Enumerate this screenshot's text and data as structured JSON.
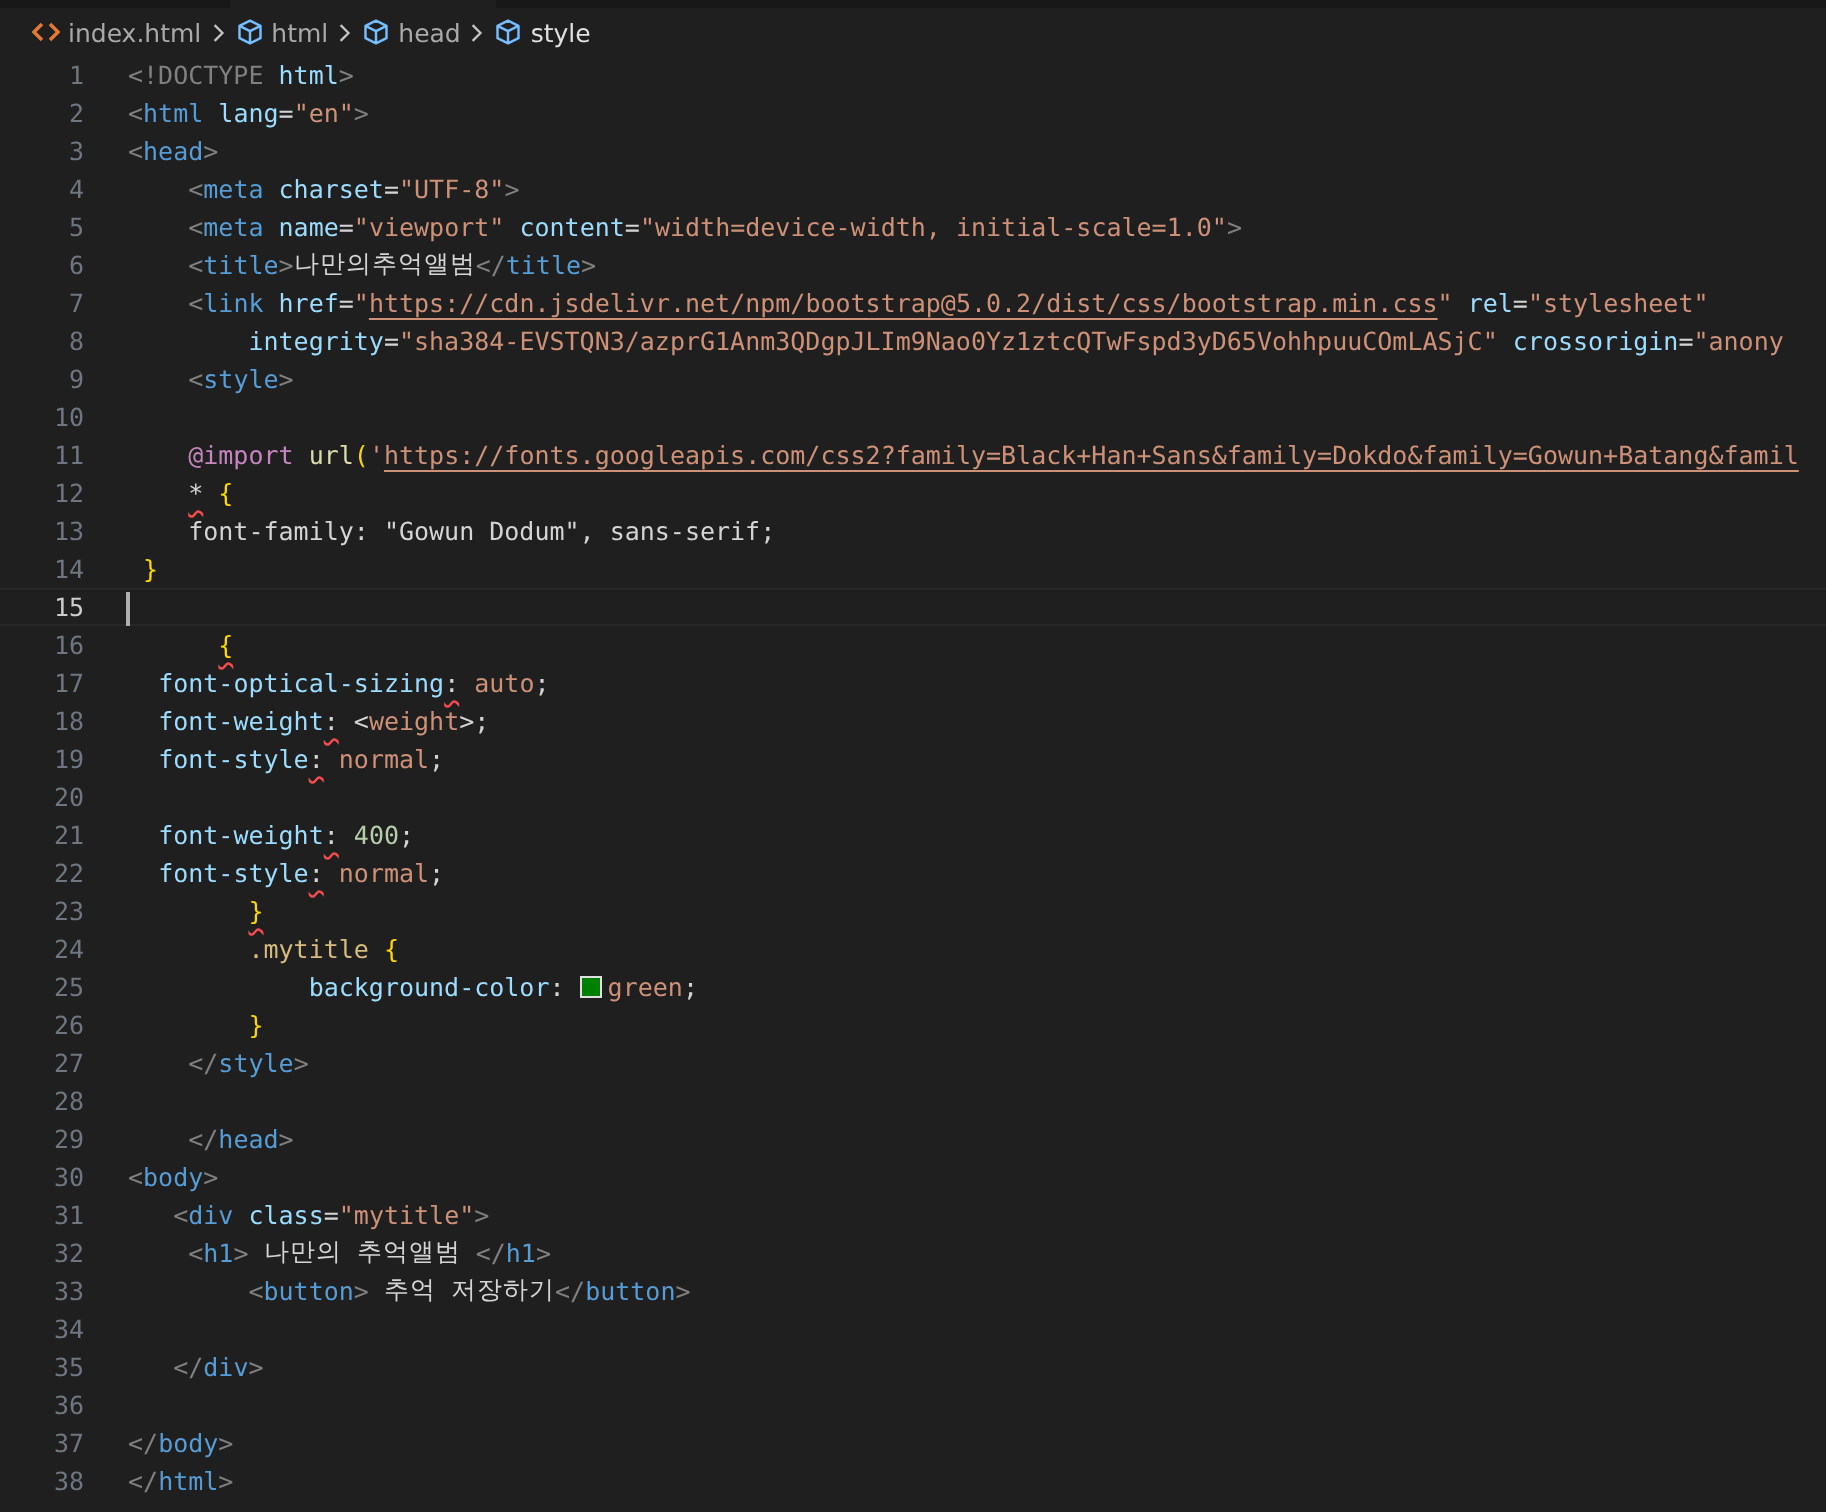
{
  "breadcrumb": [
    {
      "kind": "file",
      "label": "index.html"
    },
    {
      "kind": "element",
      "label": "html"
    },
    {
      "kind": "element",
      "label": "head"
    },
    {
      "kind": "element",
      "label": "style"
    }
  ],
  "lines": [
    {
      "number": "1",
      "tokens": [
        {
          "kind": "punct",
          "text": "<!DOCTYPE"
        },
        {
          "kind": "attr",
          "text": " html"
        },
        {
          "kind": "punct",
          "text": ">"
        }
      ]
    },
    {
      "number": "2",
      "tokens": [
        {
          "kind": "punct",
          "text": "<"
        },
        {
          "kind": "tag",
          "text": "html"
        },
        {
          "kind": "attr",
          "text": " lang"
        },
        {
          "kind": "plain",
          "text": "="
        },
        {
          "kind": "string",
          "text": "\"en\""
        },
        {
          "kind": "punct",
          "text": ">"
        }
      ]
    },
    {
      "number": "3",
      "tokens": [
        {
          "kind": "punct",
          "text": "<"
        },
        {
          "kind": "tag",
          "text": "head"
        },
        {
          "kind": "punct",
          "text": ">"
        }
      ]
    },
    {
      "number": "4",
      "tokens": [
        {
          "kind": "punct",
          "text": "    <"
        },
        {
          "kind": "tag",
          "text": "meta"
        },
        {
          "kind": "attr",
          "text": " charset"
        },
        {
          "kind": "plain",
          "text": "="
        },
        {
          "kind": "string",
          "text": "\"UTF-8\""
        },
        {
          "kind": "punct",
          "text": ">"
        }
      ]
    },
    {
      "number": "5",
      "tokens": [
        {
          "kind": "punct",
          "text": "    <"
        },
        {
          "kind": "tag",
          "text": "meta"
        },
        {
          "kind": "attr",
          "text": " name"
        },
        {
          "kind": "plain",
          "text": "="
        },
        {
          "kind": "string",
          "text": "\"viewport\""
        },
        {
          "kind": "attr",
          "text": " content"
        },
        {
          "kind": "plain",
          "text": "="
        },
        {
          "kind": "string",
          "text": "\"width=device-width, initial-scale=1.0\""
        },
        {
          "kind": "punct",
          "text": ">"
        }
      ]
    },
    {
      "number": "6",
      "tokens": [
        {
          "kind": "punct",
          "text": "    <"
        },
        {
          "kind": "tag",
          "text": "title"
        },
        {
          "kind": "punct",
          "text": ">"
        },
        {
          "kind": "text",
          "text": "나만의추억앨범"
        },
        {
          "kind": "punct",
          "text": "</"
        },
        {
          "kind": "tag",
          "text": "title"
        },
        {
          "kind": "punct",
          "text": ">"
        }
      ]
    },
    {
      "number": "7",
      "tokens": [
        {
          "kind": "punct",
          "text": "    <"
        },
        {
          "kind": "tag",
          "text": "link"
        },
        {
          "kind": "attr",
          "text": " href"
        },
        {
          "kind": "plain",
          "text": "="
        },
        {
          "kind": "string",
          "text": "\""
        },
        {
          "kind": "link",
          "text": "https://cdn.jsdelivr.net/npm/bootstrap@5.0.2/dist/css/bootstrap.min.css"
        },
        {
          "kind": "string",
          "text": "\""
        },
        {
          "kind": "attr",
          "text": " rel"
        },
        {
          "kind": "plain",
          "text": "="
        },
        {
          "kind": "string",
          "text": "\"stylesheet\""
        }
      ]
    },
    {
      "number": "8",
      "tokens": [
        {
          "kind": "attr",
          "text": "        integrity"
        },
        {
          "kind": "plain",
          "text": "="
        },
        {
          "kind": "string",
          "text": "\"sha384-EVSTQN3/azprG1Anm3QDgpJLIm9Nao0Yz1ztcQTwFspd3yD65VohhpuuCOmLASjC\""
        },
        {
          "kind": "attr",
          "text": " crossorigin"
        },
        {
          "kind": "plain",
          "text": "="
        },
        {
          "kind": "string",
          "text": "\"anony"
        }
      ]
    },
    {
      "number": "9",
      "tokens": [
        {
          "kind": "punct",
          "text": "    <"
        },
        {
          "kind": "tag",
          "text": "style"
        },
        {
          "kind": "punct",
          "text": ">"
        }
      ]
    },
    {
      "number": "10"
    },
    {
      "number": "11",
      "tokens": [
        {
          "kind": "keyword",
          "text": "    @import"
        },
        {
          "kind": "func",
          "text": " url"
        },
        {
          "kind": "bracket",
          "text": "("
        },
        {
          "kind": "string",
          "text": "'"
        },
        {
          "kind": "link",
          "text": "https://fonts.googleapis.com/css2?family=Black+Han+Sans&family=Dokdo&family=Gowun+Batang&famil"
        }
      ]
    },
    {
      "number": "12",
      "tokens": [
        {
          "kind": "plain",
          "text": "    *",
          "error": true
        },
        {
          "kind": "bracket",
          "text": " {"
        }
      ]
    },
    {
      "number": "13",
      "tokens": [
        {
          "kind": "plain",
          "text": "    font-family: \"Gowun Dodum\", sans-serif;"
        }
      ]
    },
    {
      "number": "14",
      "tokens": [
        {
          "kind": "bracket",
          "text": " }"
        }
      ]
    },
    {
      "number": "15",
      "current": true
    },
    {
      "number": "16",
      "tokens": [
        {
          "kind": "bracket",
          "text": "      {",
          "error": true
        }
      ]
    },
    {
      "number": "17",
      "tokens": [
        {
          "kind": "prop",
          "text": "  font-optical-sizing"
        },
        {
          "kind": "plain",
          "text": ":",
          "error": true
        },
        {
          "kind": "value",
          "text": " auto"
        },
        {
          "kind": "plain",
          "text": ";"
        }
      ]
    },
    {
      "number": "18",
      "tokens": [
        {
          "kind": "prop",
          "text": "  font-weight"
        },
        {
          "kind": "plain",
          "text": ":",
          "error": true
        },
        {
          "kind": "plain",
          "text": " <"
        },
        {
          "kind": "value",
          "text": "weight"
        },
        {
          "kind": "plain",
          "text": ">;"
        }
      ]
    },
    {
      "number": "19",
      "tokens": [
        {
          "kind": "prop",
          "text": "  font-style"
        },
        {
          "kind": "plain",
          "text": ":",
          "error": true
        },
        {
          "kind": "value",
          "text": " normal"
        },
        {
          "kind": "plain",
          "text": ";"
        }
      ]
    },
    {
      "number": "20"
    },
    {
      "number": "21",
      "tokens": [
        {
          "kind": "prop",
          "text": "  font-weight"
        },
        {
          "kind": "plain",
          "text": ":",
          "error": true
        },
        {
          "kind": "num",
          "text": " 400"
        },
        {
          "kind": "plain",
          "text": ";"
        }
      ]
    },
    {
      "number": "22",
      "tokens": [
        {
          "kind": "prop",
          "text": "  font-style"
        },
        {
          "kind": "plain",
          "text": ":",
          "error": true
        },
        {
          "kind": "value",
          "text": " normal"
        },
        {
          "kind": "plain",
          "text": ";"
        }
      ]
    },
    {
      "number": "23",
      "tokens": [
        {
          "kind": "bracket",
          "text": "        }",
          "error": true
        }
      ]
    },
    {
      "number": "24",
      "tokens": [
        {
          "kind": "selector",
          "text": "        .mytitle"
        },
        {
          "kind": "bracket",
          "text": " {"
        }
      ]
    },
    {
      "number": "25",
      "tokens": [
        {
          "kind": "prop",
          "text": "            background-color"
        },
        {
          "kind": "plain",
          "text": ": "
        },
        {
          "kind": "swatch",
          "color": "#008000"
        },
        {
          "kind": "value",
          "text": "green"
        },
        {
          "kind": "plain",
          "text": ";"
        }
      ]
    },
    {
      "number": "26",
      "tokens": [
        {
          "kind": "bracket",
          "text": "        }"
        }
      ]
    },
    {
      "number": "27",
      "tokens": [
        {
          "kind": "punct",
          "text": "    </"
        },
        {
          "kind": "tag",
          "text": "style"
        },
        {
          "kind": "punct",
          "text": ">"
        }
      ]
    },
    {
      "number": "28"
    },
    {
      "number": "29",
      "tokens": [
        {
          "kind": "punct",
          "text": "    </"
        },
        {
          "kind": "tag",
          "text": "head"
        },
        {
          "kind": "punct",
          "text": ">"
        }
      ]
    },
    {
      "number": "30",
      "tokens": [
        {
          "kind": "punct",
          "text": "<"
        },
        {
          "kind": "tag",
          "text": "body"
        },
        {
          "kind": "punct",
          "text": ">"
        }
      ]
    },
    {
      "number": "31",
      "tokens": [
        {
          "kind": "punct",
          "text": "   <"
        },
        {
          "kind": "tag",
          "text": "div"
        },
        {
          "kind": "attr",
          "text": " class"
        },
        {
          "kind": "plain",
          "text": "="
        },
        {
          "kind": "string",
          "text": "\"mytitle\""
        },
        {
          "kind": "punct",
          "text": ">"
        }
      ]
    },
    {
      "number": "32",
      "tokens": [
        {
          "kind": "punct",
          "text": "    <"
        },
        {
          "kind": "tag",
          "text": "h1"
        },
        {
          "kind": "punct",
          "text": ">"
        },
        {
          "kind": "text",
          "text": " 나만의 추억앨범 "
        },
        {
          "kind": "punct",
          "text": "</"
        },
        {
          "kind": "tag",
          "text": "h1"
        },
        {
          "kind": "punct",
          "text": ">"
        }
      ]
    },
    {
      "number": "33",
      "tokens": [
        {
          "kind": "punct",
          "text": "        <"
        },
        {
          "kind": "tag",
          "text": "button"
        },
        {
          "kind": "punct",
          "text": ">"
        },
        {
          "kind": "text",
          "text": " 추억 저장하기"
        },
        {
          "kind": "punct",
          "text": "</"
        },
        {
          "kind": "tag",
          "text": "button"
        },
        {
          "kind": "punct",
          "text": ">"
        }
      ]
    },
    {
      "number": "34"
    },
    {
      "number": "35",
      "tokens": [
        {
          "kind": "punct",
          "text": "   </"
        },
        {
          "kind": "tag",
          "text": "div"
        },
        {
          "kind": "punct",
          "text": ">"
        }
      ]
    },
    {
      "number": "36"
    },
    {
      "number": "37",
      "tokens": [
        {
          "kind": "punct",
          "text": "</"
        },
        {
          "kind": "tag",
          "text": "body"
        },
        {
          "kind": "punct",
          "text": ">"
        }
      ]
    },
    {
      "number": "38",
      "tokens": [
        {
          "kind": "punct",
          "text": "</"
        },
        {
          "kind": "tag",
          "text": "html"
        },
        {
          "kind": "punct",
          "text": ">"
        }
      ]
    }
  ]
}
